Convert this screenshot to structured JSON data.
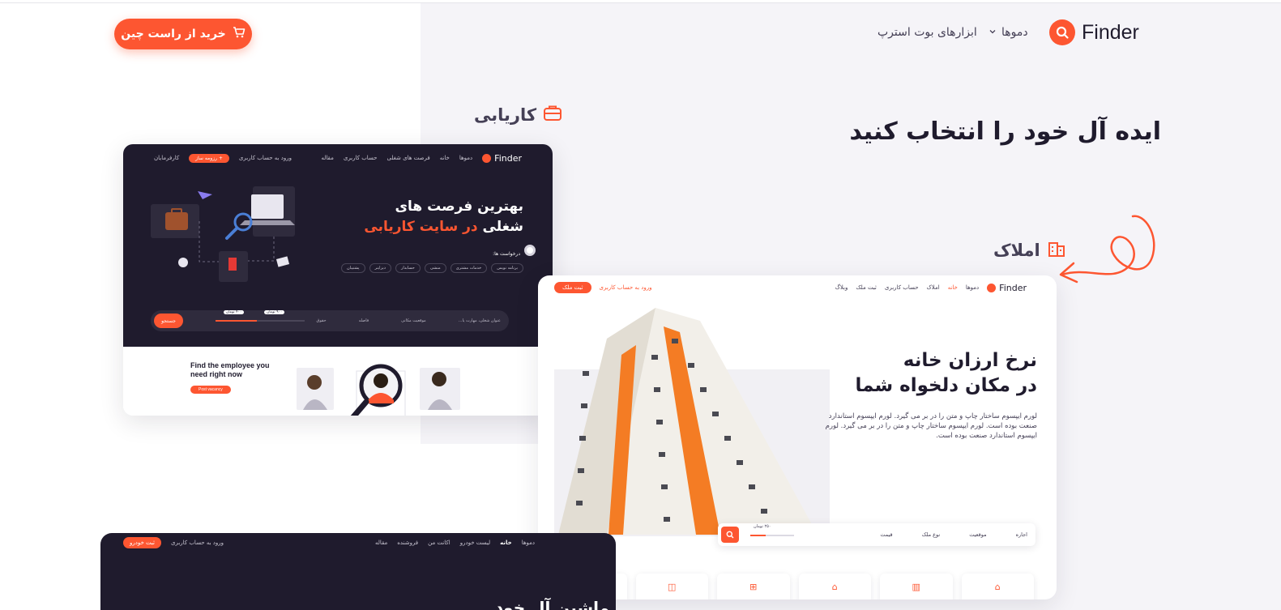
{
  "header": {
    "brand": "Finder",
    "nav": [
      {
        "label": "دموها"
      },
      {
        "label": "ابزارهای بوت استرپ"
      }
    ],
    "cta": "خرید از راست چین"
  },
  "main": {
    "title": "ایده آل خود را انتخاب کنید"
  },
  "sections": {
    "jobs": {
      "label": "کاریابی"
    },
    "estate": {
      "label": "املاک"
    }
  },
  "job_preview": {
    "brand": "Finder",
    "nav": [
      "دموها",
      "خانه",
      "فرصت های شغلی",
      "حساب کاربری",
      "مقاله"
    ],
    "login": "ورود به حساب کاربری",
    "post_btn": "+ رزومه ساز",
    "employers": "کارفرمایان",
    "heading_line1": "بهترین فرصت های",
    "heading_line2_plain": "شغلی",
    "heading_line2_accent": "در سایت کاریابی",
    "requests_label": "درخواست ها:",
    "chips": [
      "برنامه نویس",
      "خدمات مشتری",
      "منشی",
      "حسابدار",
      "دیزاینر",
      "پشتیبان"
    ],
    "search_fields": [
      "عنوان شغلی، مهارت یا...",
      "موقعیت مکانی",
      "فاصله",
      "حقوق"
    ],
    "search_btn": "جستجو",
    "slider_min": "۴۰۰ تومان",
    "slider_max": "۹۰۰ تومان",
    "slider_fraction": 0.46,
    "bottom_title": "Find the employee you need right now",
    "bottom_btn": "Post vacancy"
  },
  "estate_preview": {
    "brand": "Finder",
    "nav": [
      "دموها",
      "خانه",
      "املاک",
      "حساب کاربری",
      "ثبت ملک",
      "وبلاگ"
    ],
    "active": "خانه",
    "login": "ورود به حساب کاربری",
    "post_btn": "ثبت ملک",
    "heading_line1": "نرخ ارزان خانه",
    "heading_line2": "در مکان دلخواه شما",
    "paragraph": "لورم ایپسوم ساختار چاپ و متن را در بر می گیرد. لورم ایپسوم استاندارد صنعت بوده است. لورم ایپسوم ساختار چاپ و متن را در بر می گیرد. لورم ایپسوم استاندارد صنعت بوده است.",
    "search_fields": [
      "اجاره",
      "موقعیت",
      "نوع ملک",
      "قیمت"
    ],
    "price_label": "۲۵۰ تومان",
    "slider_fraction": 0.35,
    "categories": [
      "house-icon",
      "apartment-icon",
      "bank-icon",
      "signpost-icon",
      "office-icon",
      "more-icon"
    ],
    "more_label": "•••"
  },
  "car_preview": {
    "nav": [
      "دموها",
      "خانه",
      "لیست خودرو",
      "اکانت من",
      "فروشنده",
      "مقاله"
    ],
    "login": "ورود به حساب کاربری",
    "post_btn": "ثبت خودرو",
    "title_fragment": "ماشین آل خود"
  },
  "colors": {
    "accent": "#fd5631",
    "dark": "#1f1b2d",
    "panel": "#f5f4f8"
  }
}
